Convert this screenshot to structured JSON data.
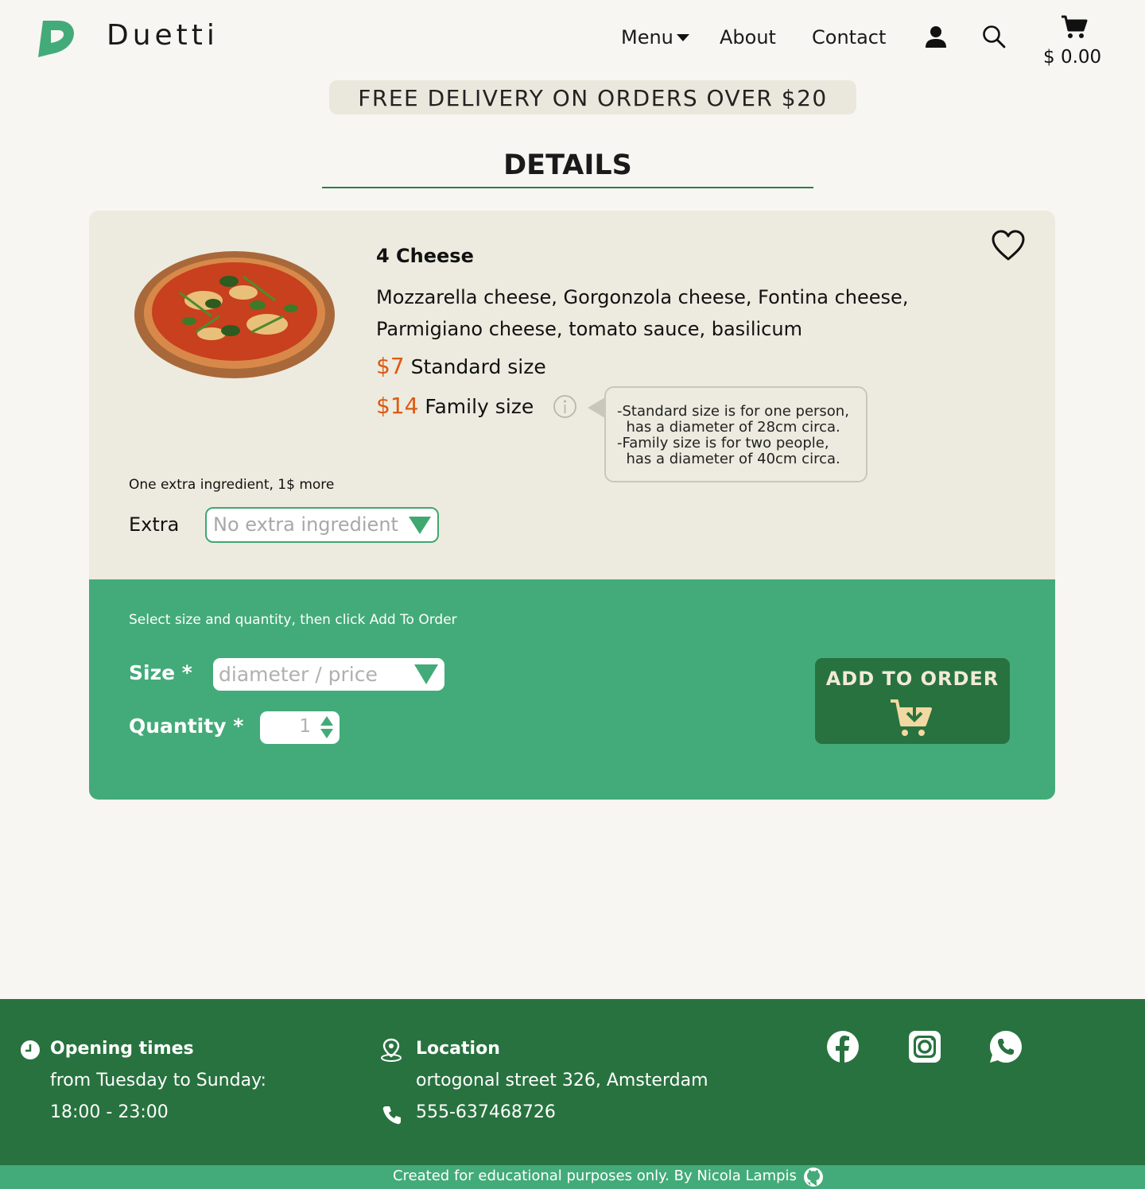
{
  "header": {
    "brand": "Duetti",
    "nav": {
      "menu": "Menu",
      "about": "About",
      "contact": "Contact"
    },
    "cart_total": "$ 0.00",
    "icons": [
      "logo-icon",
      "user-icon",
      "search-icon",
      "cart-icon"
    ]
  },
  "banner": "FREE DELIVERY ON ORDERS OVER $20",
  "page_title": "DETAILS",
  "product": {
    "name": "4 Cheese",
    "description": "Mozzarella cheese, Gorgonzola cheese, Fontina cheese, Parmigiano cheese, tomato sauce, basilicum",
    "prices": [
      {
        "amount": "$7",
        "label": "Standard size"
      },
      {
        "amount": "$14",
        "label": "Family size"
      }
    ],
    "size_info": [
      "-Standard size is for one person,",
      "  has a diameter of 28cm circa.",
      "-Family size is for two people,",
      "  has a diameter of 40cm circa."
    ],
    "extra_note": "One extra ingredient, 1$ more",
    "extra_label": "Extra",
    "extra_placeholder": "No extra ingredient"
  },
  "order": {
    "hint": "Select size and quantity, then click Add To Order",
    "size_label": "Size *",
    "size_placeholder": "diameter / price",
    "quantity_label": "Quantity *",
    "quantity_value": "1",
    "add_button": "ADD TO ORDER"
  },
  "footer": {
    "opening_title": "Opening times",
    "opening_days": "from Tuesday to Sunday:",
    "opening_hours": "18:00 - 23:00",
    "location_title": "Location",
    "address": "ortogonal street 326, Amsterdam",
    "phone": "555-637468726",
    "social": [
      "facebook-icon",
      "instagram-icon",
      "whatsapp-icon"
    ],
    "credit": "Created for educational purposes only.  By Nicola Lampis"
  },
  "colors": {
    "background": "#f7f6f2",
    "card": "#edebdf",
    "accent_green": "#43ab79",
    "dark_green": "#28723f",
    "price_orange": "#dc5a12"
  }
}
